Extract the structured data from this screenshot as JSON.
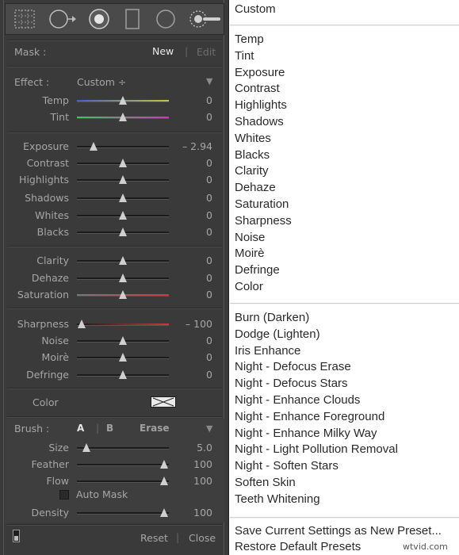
{
  "mask": {
    "label": "Mask :",
    "new_label": "New",
    "edit_label": "Edit"
  },
  "effect": {
    "label": "Effect :",
    "value": "Custom ÷",
    "collapse_glyph": "▼"
  },
  "temp_tint": [
    {
      "name": "Temp",
      "value": "0",
      "pos": 0.5,
      "gradient": [
        "#3b63c7",
        "#c7c23b"
      ]
    },
    {
      "name": "Tint",
      "value": "0",
      "pos": 0.5,
      "gradient": [
        "#3bc75c",
        "#c73bb6"
      ]
    }
  ],
  "tone": [
    {
      "name": "Exposure",
      "value": "– 2.94",
      "pos": 0.18
    },
    {
      "name": "Contrast",
      "value": "0",
      "pos": 0.5
    },
    {
      "name": "Highlights",
      "value": "0",
      "pos": 0.5
    },
    {
      "name": "Shadows",
      "value": "0",
      "pos": 0.5
    },
    {
      "name": "Whites",
      "value": "0",
      "pos": 0.5
    },
    {
      "name": "Blacks",
      "value": "0",
      "pos": 0.5
    }
  ],
  "presence": [
    {
      "name": "Clarity",
      "value": "0",
      "pos": 0.5
    },
    {
      "name": "Dehaze",
      "value": "0",
      "pos": 0.5
    },
    {
      "name": "Saturation",
      "value": "0",
      "pos": 0.5,
      "gradient": [
        "#777777",
        "#c73b3b"
      ]
    }
  ],
  "detail": [
    {
      "name": "Sharpness",
      "value": "– 100",
      "pos": 0.05,
      "gradient": [
        "#1b1b1b",
        "#c73b3b"
      ]
    },
    {
      "name": "Noise",
      "value": "0",
      "pos": 0.5
    },
    {
      "name": "Moirè",
      "value": "0",
      "pos": 0.5
    },
    {
      "name": "Defringe",
      "value": "0",
      "pos": 0.5
    }
  ],
  "color_label": "Color",
  "brush": {
    "label": "Brush :",
    "a": "A",
    "b": "B",
    "erase": "Erase",
    "collapse_glyph": "▼",
    "sliders": [
      {
        "name": "Size",
        "value": "5.0",
        "pos": 0.1
      },
      {
        "name": "Feather",
        "value": "100",
        "pos": 0.95
      },
      {
        "name": "Flow",
        "value": "100",
        "pos": 0.95
      }
    ],
    "auto_mask": "Auto Mask",
    "density": {
      "name": "Density",
      "value": "100",
      "pos": 0.95
    }
  },
  "footer": {
    "reset": "Reset",
    "close": "Close"
  },
  "menu": {
    "top": "Custom",
    "group1": [
      "Temp",
      "Tint",
      "Exposure",
      "Contrast",
      "Highlights",
      "Shadows",
      "Whites",
      "Blacks",
      "Clarity",
      "Dehaze",
      "Saturation",
      "Sharpness",
      "Noise",
      "Moirè",
      "Defringe",
      "Color"
    ],
    "group2": [
      "Burn (Darken)",
      "Dodge (Lighten)",
      "Iris Enhance",
      "Night - Defocus Erase",
      "Night - Defocus Stars",
      "Night - Enhance Clouds",
      "Night - Enhance Foreground",
      "Night - Enhance Milky Way",
      "Night - Light Pollution Removal",
      "Night - Soften Stars",
      "Soften Skin",
      "Teeth Whitening"
    ],
    "group3": [
      "Save Current Settings as New Preset...",
      "Restore Default Presets"
    ]
  },
  "watermark": "wtvid.com"
}
